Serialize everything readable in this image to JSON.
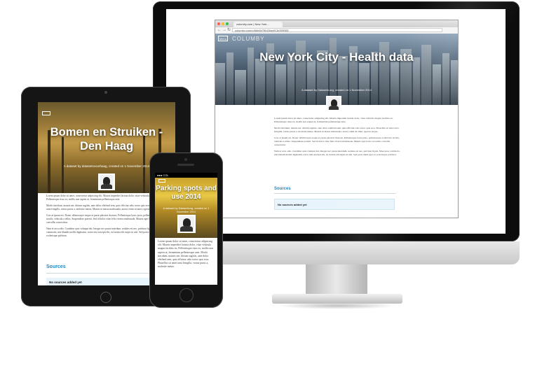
{
  "imac": {
    "browser": {
      "tab_title": "columby.com | New York...",
      "url": "columby.com/p/6bb6b7f6d26adf13e3f5f365",
      "menu_label": "Menu",
      "logo": "COLUMBY",
      "title": "New York City - Health data",
      "subtitle": "A dataset by Datasets.org, created on 1 November 2014",
      "paragraphs": [
        "Lorem ipsum dolor sit amet, consectetur adipiscing elit. Mauris imperdiet lacinia dolor, vitae vehicula magna facilisis eu. Pellentesque risus ex, mollis non sapien ut, fermentum pellentesque ante.",
        "Morbi tincidunt, mauris nec dictum sagittis, ante dolor eleifend sem, quis efficitur odio tortor quis eros. Phasellus sit amet urna fringilla, varius purus a, molestie metus. Mauris in massa malesuada, auctor enim sit amet, egestas neque.",
        "Cras at ipsum est. Donec ullamcorper neque at purus placerat rhoncus. Pellentesque lacus justo, pellentesque at ultricies iaculis, vehicula a tellus. Suspendisse potenti. Sed id dolor vitae felis viverra malesuada. Mauris eget lacus vel enim convallis consectetur.",
        "Nam et arcu odio. Curabitur quis volutpat dui. Integer nec purus interdum, sodales est nec, pulvinar ligula. Maecenas commodo, nisi blandit mollis dignissim, tortor nisi suscipit elit, eu lacinia elit turpis in nisl. Sed porta diam eget ex scelerisque pulvinar."
      ],
      "sources_heading": "Sources",
      "no_sources": "No sources added yet"
    }
  },
  "ipad": {
    "title": "Bomen en Struiken - Den Haag",
    "subtitle": "A dataset by datasetsvoorhaag, created on 1 November 2014",
    "paragraphs": [
      "Lorem ipsum dolor sit amet, consectetur adipiscing elit. Mauris imperdiet lacinia dolor, vitae vehicula magna facilisis eu. Pellentesque risus ex, mollis non sapien ut, fermentum pellentesque ante.",
      "Morbi tincidunt, mauris nec dictum sagittis, ante dolor eleifend sem, quis efficitur odio tortor quis eros. Phasellus sit amet urna fringilla, varius purus a, molestie metus. Mauris in massa malesuada, auctor enim sit amet, egestas neque.",
      "Cras at ipsum est. Donec ullamcorper neque at purus placerat rhoncus. Pellentesque lacus justo, pellentesque at ultricies iaculis, vehicula a tellus. Suspendisse potenti. Sed id dolor vitae felis viverra malesuada. Mauris eget lacus vel enim convallis consectetur.",
      "Nam et arcu odio. Curabitur quis volutpat dui. Integer nec purus interdum, sodales est nec, pulvinar ligula. Maecenas commodo, nisi blandit mollis dignissim, tortor nisi suscipit elit, eu lacinia elit turpis in nisl. Sed porta diam eget ex scelerisque pulvinar."
    ],
    "sources_heading": "Sources",
    "no_sources": "No sources added yet"
  },
  "iphone": {
    "carrier": "COL",
    "title": "Parking spots and use 2014",
    "subtitle": "A dataset by Datasetsorg, created on 1 November 2014",
    "paragraph": "Lorem ipsum dolor sit amet, consectetur adipiscing elit. Mauris imperdiet lacinia dolor, vitae vehicula magna facilisis eu. Pellentesque risus ex, mollis non sapien ut, fermentum pellentesque ante. Morbi tincidunt, mauris nec dictum sagittis, ante dolor eleifend sem, quis efficitur odio tortor quis eros. Phasellus sit amet urna fringilla, varius purus a, molestie metus."
  },
  "colors": {
    "accent": "#1e88c8",
    "source_box": "#e8f4fb"
  }
}
